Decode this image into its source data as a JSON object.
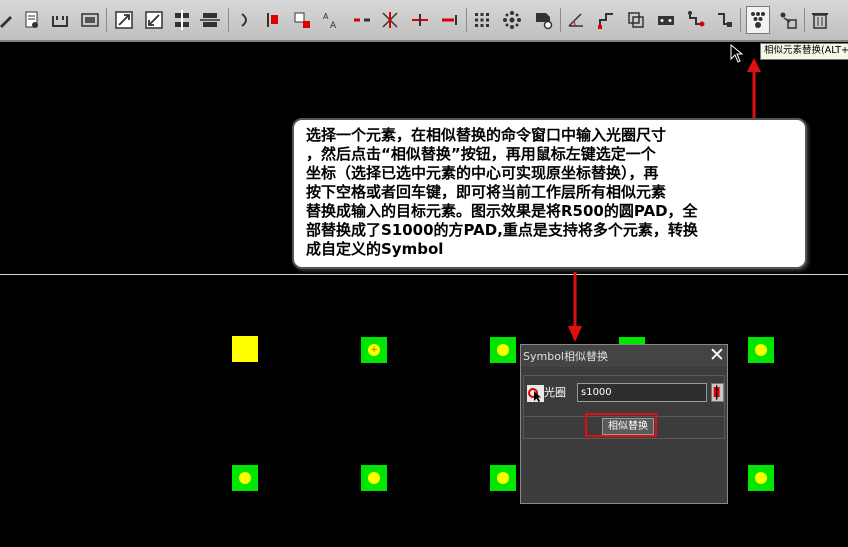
{
  "toolbar": {
    "items": [
      {
        "name": "edit-tool-icon",
        "active": false
      },
      {
        "name": "doc-settings-icon",
        "active": false
      },
      {
        "name": "frame-icon",
        "active": false
      },
      {
        "name": "select-box-icon",
        "active": false
      },
      {
        "name": "resize-up-icon",
        "active": false
      },
      {
        "name": "resize-down-icon",
        "active": false
      },
      {
        "name": "align-center-icon",
        "active": false
      },
      {
        "name": "align-split-icon",
        "active": false
      },
      {
        "name": "arc-icon",
        "active": false
      },
      {
        "name": "pad-red-icon",
        "active": false
      },
      {
        "name": "pad-corner-icon",
        "active": false
      },
      {
        "name": "text-size-icon",
        "active": false
      },
      {
        "name": "line-dash-icon",
        "active": false
      },
      {
        "name": "cross-line-icon",
        "active": false
      },
      {
        "name": "line-split-icon",
        "active": false
      },
      {
        "name": "line-end-icon",
        "active": false
      },
      {
        "name": "grid-array-icon",
        "active": false
      },
      {
        "name": "snowflake-icon",
        "active": false
      },
      {
        "name": "symbol-gear-icon",
        "active": false
      },
      {
        "name": "angle-icon",
        "active": false
      },
      {
        "name": "step-icon",
        "active": false
      },
      {
        "name": "overlap-icon",
        "active": false
      },
      {
        "name": "drive-icon",
        "active": false
      },
      {
        "name": "route-icon",
        "active": false
      },
      {
        "name": "route-alt-icon",
        "active": false
      },
      {
        "name": "similar-replace-icon",
        "active": true
      },
      {
        "name": "replace-alt-icon",
        "active": false
      },
      {
        "name": "trash-icon",
        "active": false
      }
    ]
  },
  "tooltip": "相似元素替换(ALT+",
  "callout": {
    "lines": [
      "选择一个元素，在相似替换的命令窗口中输入光圈尺寸",
      "，然后点击“相似替换”按钮，再用鼠标左键选定一个",
      "坐标（选择已选中元素的中心可实现原坐标替换），再",
      "按下空格或者回车键，即可将当前工作层所有相似元素",
      "替换成输入的目标元素。图示效果是将R500的圆PAD，全",
      "部替换成了S1000的方PAD,重点是支持将多个元素，转换",
      "成自定义的Symbol"
    ]
  },
  "dialog": {
    "title": "Symbol相似替换",
    "close": "✕",
    "aperture_label": "光圈",
    "aperture_value": "s1000",
    "replace_button": "相似替换"
  },
  "colors": {
    "pad_green": "#00e600",
    "pad_yellow": "#ffff00",
    "arrow_red": "#e01010",
    "background": "#000000"
  }
}
